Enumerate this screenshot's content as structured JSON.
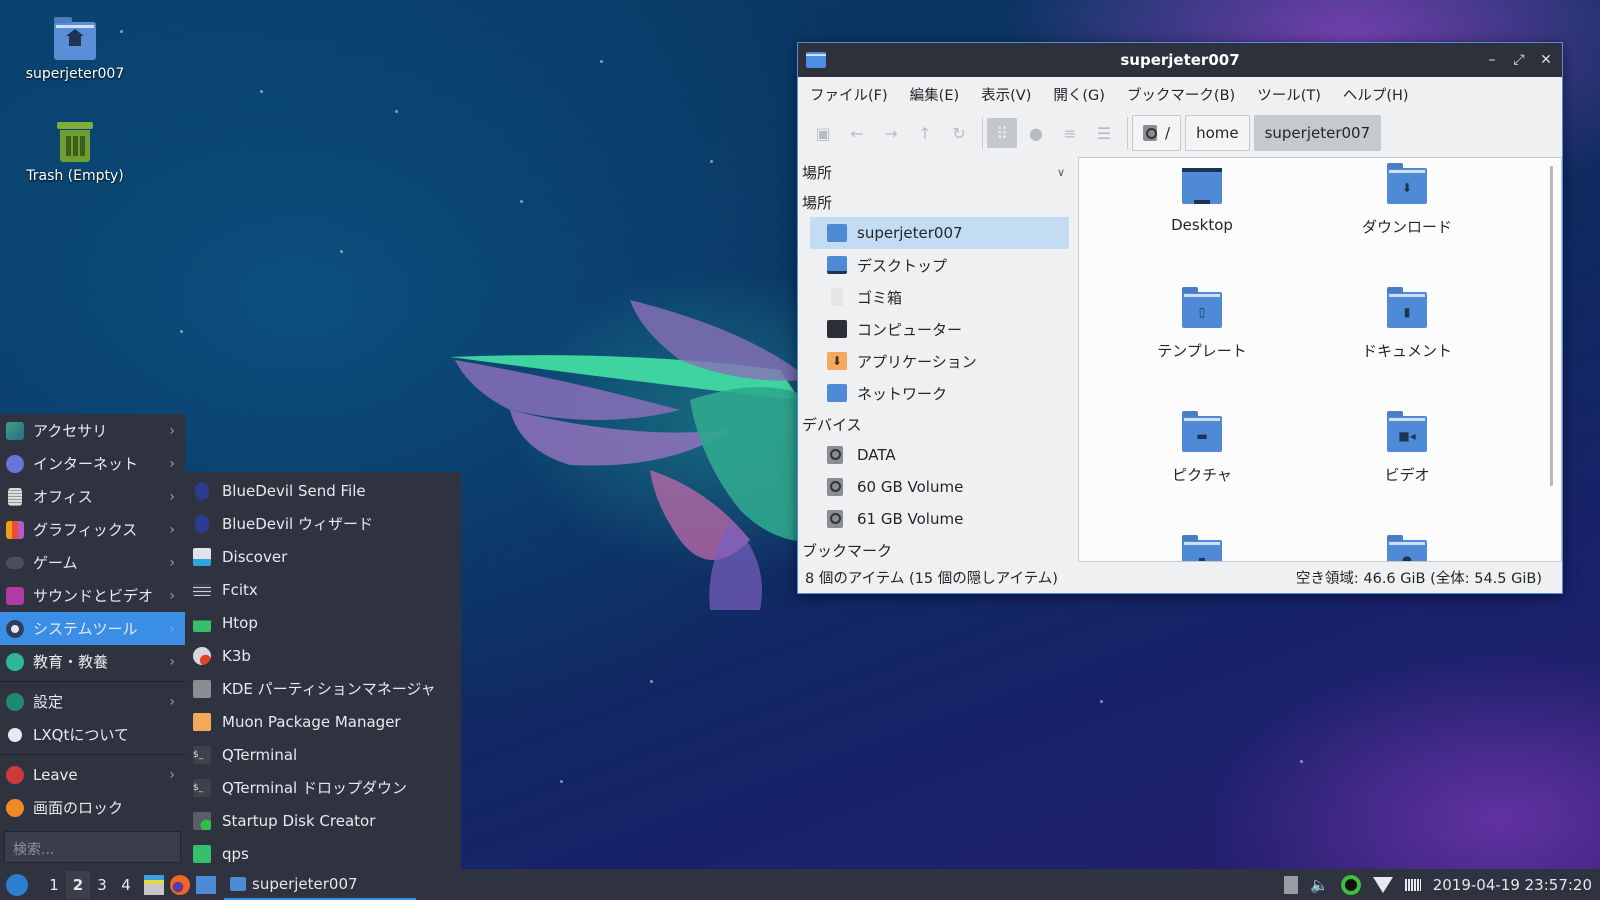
{
  "desktop": {
    "icons": [
      {
        "label": "superjeter007",
        "icon": "home-folder-icon"
      },
      {
        "label": "Trash (Empty)",
        "icon": "trash-icon"
      }
    ]
  },
  "start_menu": {
    "categories": [
      {
        "label": "アクセサリ",
        "icon": "accessories-icon",
        "has_submenu": true
      },
      {
        "label": "インターネット",
        "icon": "internet-icon",
        "has_submenu": true
      },
      {
        "label": "オフィス",
        "icon": "office-icon",
        "has_submenu": true
      },
      {
        "label": "グラフィックス",
        "icon": "graphics-icon",
        "has_submenu": true
      },
      {
        "label": "ゲーム",
        "icon": "games-icon",
        "has_submenu": true
      },
      {
        "label": "サウンドとビデオ",
        "icon": "multimedia-icon",
        "has_submenu": true
      },
      {
        "label": "システムツール",
        "icon": "system-tools-icon",
        "has_submenu": true,
        "active": true
      },
      {
        "label": "教育・教養",
        "icon": "education-icon",
        "has_submenu": true
      }
    ],
    "settings": {
      "label": "設定",
      "icon": "settings-icon"
    },
    "about": {
      "label": "LXQtについて",
      "icon": "info-icon"
    },
    "leave": {
      "label": "Leave",
      "icon": "power-icon"
    },
    "lock": {
      "label": "画面のロック",
      "icon": "lock-icon"
    },
    "search_placeholder": "検索..."
  },
  "system_tools_submenu": [
    {
      "label": "BlueDevil Send File",
      "icon": "bluetooth-icon"
    },
    {
      "label": "BlueDevil ウィザード",
      "icon": "bluetooth-icon"
    },
    {
      "label": "Discover",
      "icon": "discover-icon"
    },
    {
      "label": "Fcitx",
      "icon": "keyboard-icon"
    },
    {
      "label": "Htop",
      "icon": "htop-icon"
    },
    {
      "label": "K3b",
      "icon": "k3b-icon"
    },
    {
      "label": "KDE パーティションマネージャ",
      "icon": "partition-manager-icon"
    },
    {
      "label": "Muon Package Manager",
      "icon": "muon-icon"
    },
    {
      "label": "QTerminal",
      "icon": "terminal-icon"
    },
    {
      "label": "QTerminal ドロップダウン",
      "icon": "terminal-icon"
    },
    {
      "label": "Startup Disk Creator",
      "icon": "startup-disk-icon"
    },
    {
      "label": "qps",
      "icon": "qps-icon"
    }
  ],
  "file_manager": {
    "title": "superjeter007",
    "menu": [
      "ファイル(F)",
      "編集(E)",
      "表示(V)",
      "開く(G)",
      "ブックマーク(B)",
      "ツール(T)",
      "ヘルプ(H)"
    ],
    "window_buttons": {
      "minimize": "–",
      "maximize": "⤢",
      "close": "✕"
    },
    "breadcrumb": [
      "/",
      "home",
      "superjeter007"
    ],
    "sidebar": {
      "header": "場所",
      "places_label": "場所",
      "places": [
        {
          "label": "superjeter007",
          "icon": "home-folder-icon",
          "selected": true
        },
        {
          "label": "デスクトップ",
          "icon": "desktop-icon"
        },
        {
          "label": "ゴミ箱",
          "icon": "trash-icon"
        },
        {
          "label": "コンピューター",
          "icon": "computer-icon"
        },
        {
          "label": "アプリケーション",
          "icon": "applications-icon"
        },
        {
          "label": "ネットワーク",
          "icon": "network-icon"
        }
      ],
      "devices_label": "デバイス",
      "devices": [
        {
          "label": "DATA",
          "icon": "drive-icon"
        },
        {
          "label": "60 GB Volume",
          "icon": "drive-icon"
        },
        {
          "label": "61 GB Volume",
          "icon": "drive-icon"
        }
      ],
      "bookmarks_label": "ブックマーク"
    },
    "files": [
      {
        "label": "Desktop",
        "icon": "desktop-folder-icon"
      },
      {
        "label": "ダウンロード",
        "icon": "downloads-folder-icon"
      },
      {
        "label": "テンプレート",
        "icon": "templates-folder-icon"
      },
      {
        "label": "ドキュメント",
        "icon": "documents-folder-icon"
      },
      {
        "label": "ピクチャ",
        "icon": "pictures-folder-icon"
      },
      {
        "label": "ビデオ",
        "icon": "videos-folder-icon"
      },
      {
        "label": "",
        "icon": "music-folder-icon"
      },
      {
        "label": "",
        "icon": "public-folder-icon"
      }
    ],
    "status_left": "8 個のアイテム (15 個の隠しアイテム)",
    "status_right": "空き領域: 46.6 GiB (全体: 54.5 GiB)"
  },
  "taskbar": {
    "desktops": [
      "1",
      "2",
      "3",
      "4"
    ],
    "current_desktop": "2",
    "task_label": "superjeter007",
    "clock": "2019-04-19 23:57:20"
  },
  "colors": {
    "accent": "#3a8ee6",
    "panel": "#2f3340",
    "folder": "#4e8ad6",
    "selection": "#c3dcf3"
  }
}
